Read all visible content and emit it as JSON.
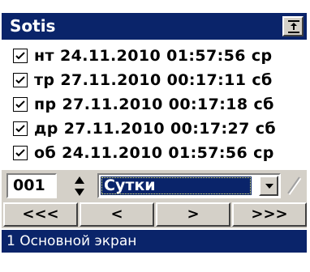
{
  "window": {
    "title": "Sotis"
  },
  "events": [
    {
      "checked": true,
      "text": "нт 24.11.2010 01:57:56 ср"
    },
    {
      "checked": true,
      "text": "тр 27.11.2010 00:17:11 сб"
    },
    {
      "checked": true,
      "text": "пр 27.11.2010 00:17:18 сб"
    },
    {
      "checked": true,
      "text": "др 27.11.2010 00:17:27 сб"
    },
    {
      "checked": true,
      "text": "об 24.11.2010 01:57:56 ср"
    }
  ],
  "controls": {
    "number_value": "001",
    "period_selected": "Сутки"
  },
  "nav": {
    "first": "<<<",
    "prev": "<",
    "next": ">",
    "last": ">>>"
  },
  "screens": [
    {
      "label": "1 Основной экран",
      "selected": true
    }
  ],
  "colors": {
    "title_bg": "#0a246a",
    "face": "#d4d0c8",
    "selection": "#0a246a"
  }
}
